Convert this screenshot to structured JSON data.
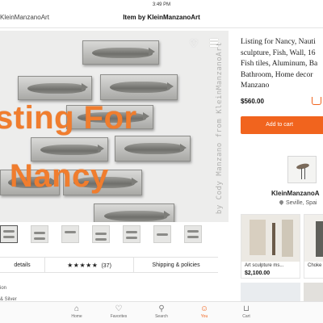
{
  "status": {
    "time": "3:49 PM"
  },
  "topbar": {
    "shop_link": "KleinManzanoArt",
    "title": "Item by KleinManzanoArt"
  },
  "main_image": {
    "overlay_line1": "sting For",
    "overlay_line2": "Nancy",
    "watermark": "by Cody Manzano from KleinManzanoArt",
    "accent_color": "#f07d2e"
  },
  "thumbnails": {
    "count": 8
  },
  "tabs": [
    {
      "label": "details"
    },
    {
      "label": "★★★★★",
      "count": "(37)"
    },
    {
      "label": "Shipping & policies"
    }
  ],
  "description_partial": [
    "ion",
    "& Silver"
  ],
  "listing": {
    "title_lines": [
      "Listing for Nancy, Nauti",
      "sculpture, Fish, Wall, 16",
      "Fish tiles, Aluminum, Ba",
      "Bathroom, Home decor",
      "Manzano"
    ],
    "price": "$560.00",
    "add_to_cart": "Add to cart",
    "brand_color": "#f1641e"
  },
  "shop": {
    "name": "KleinManzanoA",
    "location": "Seville, Spai"
  },
  "related": [
    {
      "title": "Art sculpture ms...",
      "price": "$2,100.00"
    },
    {
      "title": "Choke",
      "price": ""
    }
  ],
  "nav": [
    {
      "label": "Home",
      "icon": "home-icon"
    },
    {
      "label": "Favorites",
      "icon": "heart-icon"
    },
    {
      "label": "Search",
      "icon": "search-icon"
    },
    {
      "label": "You",
      "icon": "person-icon",
      "active": true
    },
    {
      "label": "Cart",
      "icon": "cart-icon"
    }
  ]
}
